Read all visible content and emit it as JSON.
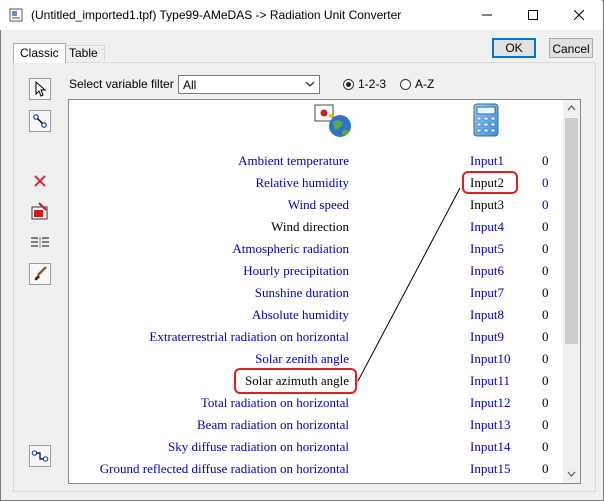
{
  "window": {
    "title": "(Untitled_imported1.tpf) Type99-AMeDAS -> Radiation Unit Converter"
  },
  "tabs": [
    {
      "label": "Classic"
    },
    {
      "label": "Table"
    }
  ],
  "buttons": {
    "ok": "OK",
    "cancel": "Cancel"
  },
  "filter": {
    "label": "Select variable filter :",
    "selected": "All"
  },
  "sort": {
    "option_numeric": "1-2-3",
    "option_alpha": "A-Z",
    "selected": "1-2-3"
  },
  "tools": [
    "pointer-tool",
    "link-tool",
    "delete-tool",
    "delete-link-tool",
    "align-tool",
    "paint-tool",
    "auto-link-tool"
  ],
  "headers": {
    "source_icon": "weather-station-icon",
    "target_icon": "calculator-icon"
  },
  "rows": [
    {
      "source": "Ambient temperature",
      "input": "Input1",
      "value": "0"
    },
    {
      "source": "Relative humidity",
      "input": "Input2",
      "value": "0"
    },
    {
      "source": "Wind speed",
      "input": "Input3",
      "value": "0"
    },
    {
      "source": "Wind direction",
      "input": "Input4",
      "value": "0"
    },
    {
      "source": "Atmospheric radiation",
      "input": "Input5",
      "value": "0"
    },
    {
      "source": "Hourly precipitation",
      "input": "Input6",
      "value": "0"
    },
    {
      "source": "Sunshine duration",
      "input": "Input7",
      "value": "0"
    },
    {
      "source": "Absolute humidity",
      "input": "Input8",
      "value": "0"
    },
    {
      "source": "Extraterrestrial radiation on horizontal",
      "input": "Input9",
      "value": "0"
    },
    {
      "source": "Solar zenith angle",
      "input": "Input10",
      "value": "0"
    },
    {
      "source": "Solar azimuth angle",
      "input": "Input11",
      "value": "0"
    },
    {
      "source": "Total radiation on horizontal",
      "input": "Input12",
      "value": "0"
    },
    {
      "source": "Beam radiation on horizontal",
      "input": "Input13",
      "value": "0"
    },
    {
      "source": "Sky diffuse radiation on horizontal",
      "input": "Input14",
      "value": "0"
    },
    {
      "source": "Ground reflected diffuse radiation on horizontal",
      "input": "Input15",
      "value": "0"
    }
  ],
  "link": {
    "from": "Solar azimuth angle",
    "to": "Input2"
  },
  "colors": {
    "link_text": "#0000c0",
    "highlight": "#e02020",
    "ok_focus": "#0078d7"
  }
}
